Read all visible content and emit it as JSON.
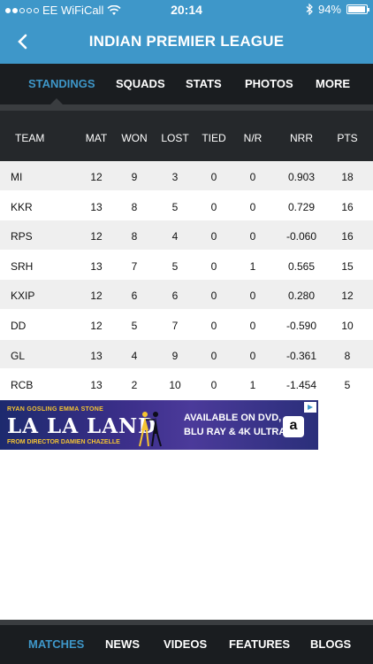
{
  "status_bar": {
    "carrier": "EE WiFiCall",
    "time": "20:14",
    "battery": "94%",
    "battery_level": 0.94
  },
  "header": {
    "title": "INDIAN PREMIER LEAGUE",
    "back_icon": "chevron-left-icon"
  },
  "tabs": [
    {
      "label": "STANDINGS",
      "active": true
    },
    {
      "label": "SQUADS",
      "active": false
    },
    {
      "label": "STATS",
      "active": false
    },
    {
      "label": "PHOTOS",
      "active": false
    },
    {
      "label": "MORE",
      "active": false
    }
  ],
  "table": {
    "columns": [
      "TEAM",
      "MAT",
      "WON",
      "LOST",
      "TIED",
      "N/R",
      "NRR",
      "PTS"
    ],
    "rows": [
      [
        "MI",
        "12",
        "9",
        "3",
        "0",
        "0",
        "0.903",
        "18"
      ],
      [
        "KKR",
        "13",
        "8",
        "5",
        "0",
        "0",
        "0.729",
        "16"
      ],
      [
        "RPS",
        "12",
        "8",
        "4",
        "0",
        "0",
        "-0.060",
        "16"
      ],
      [
        "SRH",
        "13",
        "7",
        "5",
        "0",
        "1",
        "0.565",
        "15"
      ],
      [
        "KXIP",
        "12",
        "6",
        "6",
        "0",
        "0",
        "0.280",
        "12"
      ],
      [
        "DD",
        "12",
        "5",
        "7",
        "0",
        "0",
        "-0.590",
        "10"
      ],
      [
        "GL",
        "13",
        "4",
        "9",
        "0",
        "0",
        "-0.361",
        "8"
      ],
      [
        "RCB",
        "13",
        "2",
        "10",
        "0",
        "1",
        "-1.454",
        "5"
      ]
    ]
  },
  "ad": {
    "actors": "RYAN GOSLING   EMMA STONE",
    "movie": "LA LA LAND",
    "director": "FROM DIRECTOR DAMIEN CHAZELLE",
    "line1": "AVAILABLE ON DVD,",
    "line2": "BLU RAY & 4K ULTRA.",
    "brand": "a"
  },
  "bottom_nav": [
    {
      "label": "MATCHES",
      "active": true
    },
    {
      "label": "NEWS",
      "active": false
    },
    {
      "label": "VIDEOS",
      "active": false
    },
    {
      "label": "FEATURES",
      "active": false
    },
    {
      "label": "BLOGS",
      "active": false
    }
  ],
  "colors": {
    "accent": "#3e97c9",
    "dark": "#1a1d20",
    "header_row": "#25282b"
  }
}
